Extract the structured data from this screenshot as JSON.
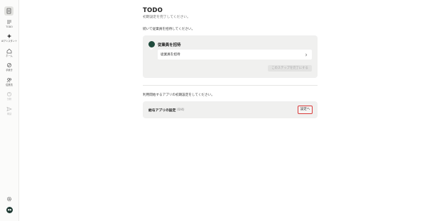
{
  "sidebar": {
    "items": [
      {
        "label": "TODO",
        "icon": "todo-list-icon",
        "enabled": true
      },
      {
        "label": "AIアシスタント",
        "icon": "sparkle-icon",
        "enabled": true
      },
      {
        "label": "ホーム",
        "icon": "home-icon",
        "enabled": true
      },
      {
        "label": "手続き",
        "icon": "procedure-icon",
        "enabled": true
      },
      {
        "label": "従業員",
        "icon": "employees-icon",
        "enabled": true
      },
      {
        "label": "分析",
        "icon": "analytics-icon",
        "enabled": false
      },
      {
        "label": "申請",
        "icon": "send-icon",
        "enabled": false
      }
    ],
    "avatar_text": "●●"
  },
  "header": {
    "title": "TODO",
    "subtitle": "初期設定を完了してください。"
  },
  "section1": {
    "label": "続いて従業員を招待してください。",
    "card_title": "従業員を招待",
    "invite_row": "従業員を招待",
    "complete_button": "このステップを完了にする"
  },
  "section2": {
    "label": "利用開始するアプリの初期設定をしてください。",
    "row_title": "給与アプリの設定",
    "row_count": "(0/4)",
    "goto_button": "設定へ"
  },
  "colors": {
    "accent": "#1f4a3c",
    "highlight_border": "#d93a3a"
  }
}
